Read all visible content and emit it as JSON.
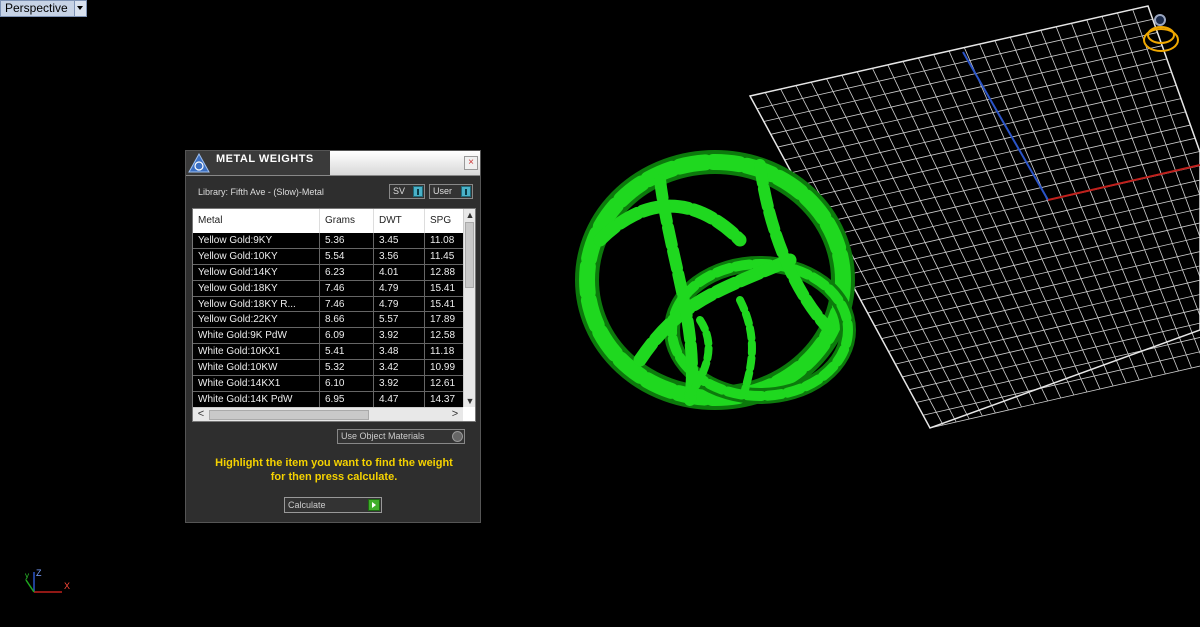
{
  "viewport": {
    "label": "Perspective"
  },
  "panel": {
    "title": "METAL WEIGHTS",
    "close_glyph": "×",
    "library_label": "Library: Fifth Ave - (Slow)-Metal",
    "sg_select": "SV",
    "user_select": "User",
    "columns": [
      "Metal",
      "Grams",
      "DWT",
      "SPG"
    ],
    "rows": [
      [
        "Yellow Gold:9KY",
        "5.36",
        "3.45",
        "11.08"
      ],
      [
        "Yellow Gold:10KY",
        "5.54",
        "3.56",
        "11.45"
      ],
      [
        "Yellow Gold:14KY",
        "6.23",
        "4.01",
        "12.88"
      ],
      [
        "Yellow Gold:18KY",
        "7.46",
        "4.79",
        "15.41"
      ],
      [
        "Yellow Gold:18KY R...",
        "7.46",
        "4.79",
        "15.41"
      ],
      [
        "Yellow Gold:22KY",
        "8.66",
        "5.57",
        "17.89"
      ],
      [
        "White Gold:9K PdW",
        "6.09",
        "3.92",
        "12.58"
      ],
      [
        "White Gold:10KX1",
        "5.41",
        "3.48",
        "11.18"
      ],
      [
        "White Gold:10KW",
        "5.32",
        "3.42",
        "10.99"
      ],
      [
        "White Gold:14KX1",
        "6.10",
        "3.92",
        "12.61"
      ],
      [
        "White Gold:14K PdW",
        "6.95",
        "4.47",
        "14.37"
      ]
    ],
    "scroll": {
      "up": "▲",
      "down": "▼",
      "left": "<",
      "right": ">"
    },
    "object_materials_label": "Use Object Materials",
    "hint_line1": "Highlight the item you want to find the weight",
    "hint_line2": "for then press calculate.",
    "calculate_label": "Calculate"
  },
  "axis_labels": {
    "z": "Z",
    "y": "y",
    "x": "X"
  },
  "colors": {
    "ring": "#1fd81f",
    "grid": "#d8d8d8",
    "axis_x": "#c0201c",
    "axis_y": "#2a54c8",
    "hint": "#f5d200"
  }
}
